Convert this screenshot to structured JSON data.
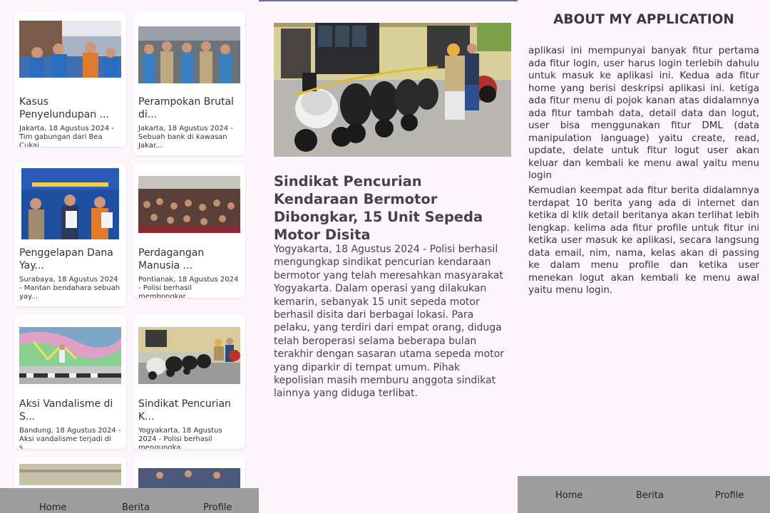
{
  "news_list": {
    "cards": [
      {
        "title": "Kasus Penyelundupan ...",
        "excerpt": "Jakarta, 18 Agustus 2024 - Tim gabungan dari Bea Cukai ..."
      },
      {
        "title": "Perampokan Brutal di...",
        "excerpt": "Jakarta, 18 Agustus 2024 - Sebuah bank di kawasan Jakar..."
      },
      {
        "title": "Penggelapan Dana Yay...",
        "excerpt": "Surabaya, 18 Agustus 2024 - Mantan bendahara sebuah yay..."
      },
      {
        "title": "Perdagangan Manusia ...",
        "excerpt": "Pontianak, 18 Agustus 2024 - Polisi berhasil membongkar..."
      },
      {
        "title": "Aksi Vandalisme di S...",
        "excerpt": "Bandung, 18 Agustus 2024 - Aksi vandalisme terjadi di s..."
      },
      {
        "title": "Sindikat Pencurian K...",
        "excerpt": "Yogyakarta, 18 Agustus 2024 - Polisi berhasil mengungka..."
      }
    ]
  },
  "bottom_nav": {
    "home": "Home",
    "berita": "Berita",
    "profile": "Profile"
  },
  "detail": {
    "title": "Sindikat Pencurian Kendaraan Bermotor Dibongkar, 15 Unit Sepeda Motor Disita",
    "body": "Yogyakarta, 18 Agustus 2024 - Polisi berhasil mengungkap sindikat pencurian kendaraan bermotor yang telah meresahkan masyarakat Yogyakarta. Dalam operasi yang dilakukan kemarin, sebanyak 15 unit sepeda motor berhasil disita dari berbagai lokasi. Para pelaku, yang terdiri dari empat orang, diduga telah beroperasi selama beberapa bulan terakhir dengan sasaran utama sepeda motor yang diparkir di tempat umum. Pihak kepolisian masih memburu anggota sindikat lainnya yang diduga terlibat."
  },
  "about": {
    "heading": "ABOUT MY APPLICATION",
    "paragraph1": "aplikasi ini mempunyai banyak fitur pertama ada fitur login, user harus login terlebih dahulu untuk masuk ke aplikasi ini. Kedua ada fitur home yang berisi deskripsi aplikasi ini. ketiga ada fitur menu di pojok kanan atas didalamnya ada fitur tambah data, detail data dan logut, user bisa menggunakan fitur DML (data manipulation language) yaitu create, read, update, delate untuk fitur logut user akan keluar dan kembali ke menu awal yaitu menu login",
    "paragraph2": "Kemudian keempat ada fitur berita didalamnya terdapat 10 berita yang ada di internet dan ketika di klik detail beritanya akan terlihat lebih lengkap. kelima ada fitur profile untuk fitur ini ketika user masuk ke aplikasi, secara langsung data email, nim, nama, kelas akan di passing ke dalam menu profile dan ketika user menekan logut akan kembali ke menu awal yaitu menu login."
  },
  "colors": {
    "background": "#fdf7fd",
    "nav_bar": "#9e9e9e",
    "card": "#ffffff",
    "accent_line": "#6c6aa8"
  }
}
